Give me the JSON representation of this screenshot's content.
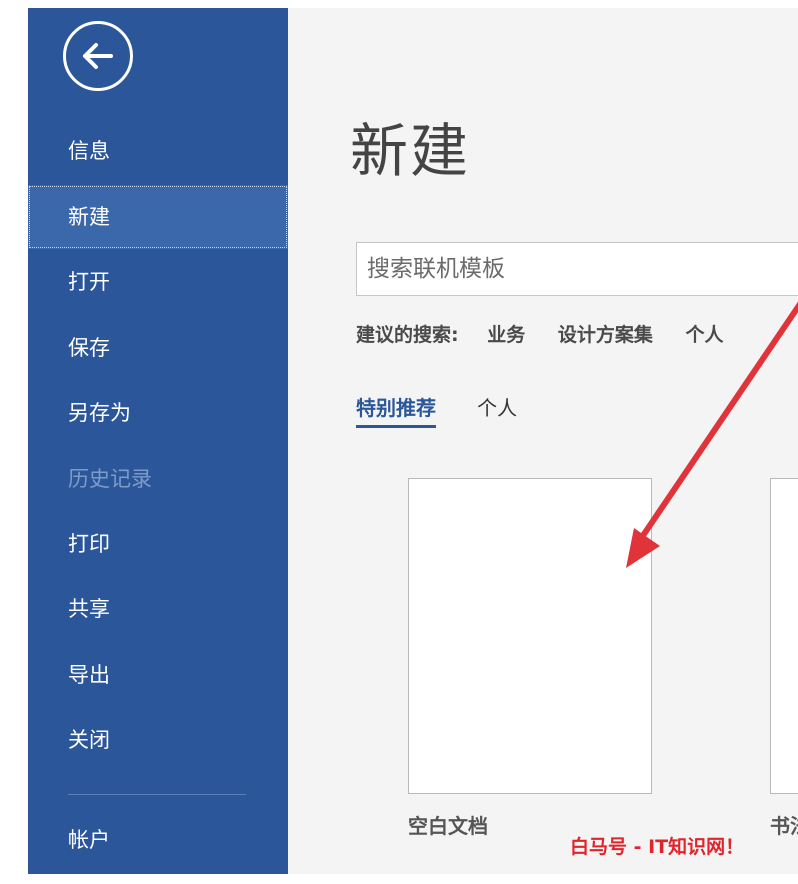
{
  "sidebar": {
    "back_icon": "back-arrow-circle-icon",
    "items": [
      {
        "label": "信息",
        "state": "normal"
      },
      {
        "label": "新建",
        "state": "selected"
      },
      {
        "label": "打开",
        "state": "normal"
      },
      {
        "label": "保存",
        "state": "normal"
      },
      {
        "label": "另存为",
        "state": "normal"
      },
      {
        "label": "历史记录",
        "state": "disabled"
      },
      {
        "label": "打印",
        "state": "normal"
      },
      {
        "label": "共享",
        "state": "normal"
      },
      {
        "label": "导出",
        "state": "normal"
      },
      {
        "label": "关闭",
        "state": "normal"
      }
    ],
    "account_label": "帐户"
  },
  "main": {
    "title": "新建",
    "search": {
      "placeholder": "搜索联机模板",
      "value": ""
    },
    "suggested": {
      "label": "建议的搜索:",
      "links": [
        "业务",
        "设计方案集",
        "个人"
      ]
    },
    "tabs": [
      {
        "label": "特别推荐",
        "active": true
      },
      {
        "label": "个人",
        "active": false
      }
    ],
    "templates": [
      {
        "label": "空白文档"
      },
      {
        "label": "书法"
      }
    ]
  },
  "watermark": "白马号 - IT知识网！",
  "colors": {
    "sidebar_bg": "#2b579a",
    "sidebar_selected": "#3b68ab",
    "accent": "#2b579a",
    "annotation_arrow": "#e0343a",
    "watermark": "#e0242b"
  }
}
